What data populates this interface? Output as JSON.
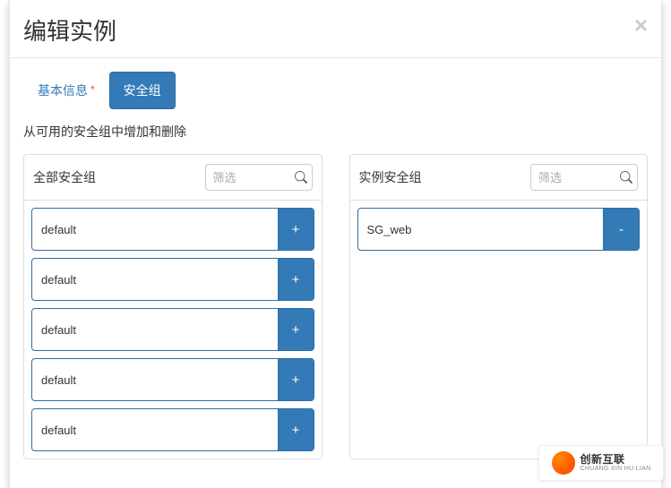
{
  "modal": {
    "title": "编辑实例",
    "close_label": "×"
  },
  "tabs": [
    {
      "label": "基本信息",
      "required": true,
      "active": false
    },
    {
      "label": "安全组",
      "required": false,
      "active": true
    }
  ],
  "description": "从可用的安全组中增加和删除",
  "filter_placeholder": "筛选",
  "left_panel": {
    "title": "全部安全组",
    "items": [
      {
        "name": "default"
      },
      {
        "name": "default"
      },
      {
        "name": "default"
      },
      {
        "name": "default"
      },
      {
        "name": "default"
      }
    ],
    "action_label": "+"
  },
  "right_panel": {
    "title": "实例安全组",
    "items": [
      {
        "name": "SG_web"
      }
    ],
    "action_label": "-"
  },
  "icons": {
    "search": "search-icon"
  },
  "watermark": {
    "cn": "创新互联",
    "en": "CHUANG XIN HU LIAN"
  }
}
